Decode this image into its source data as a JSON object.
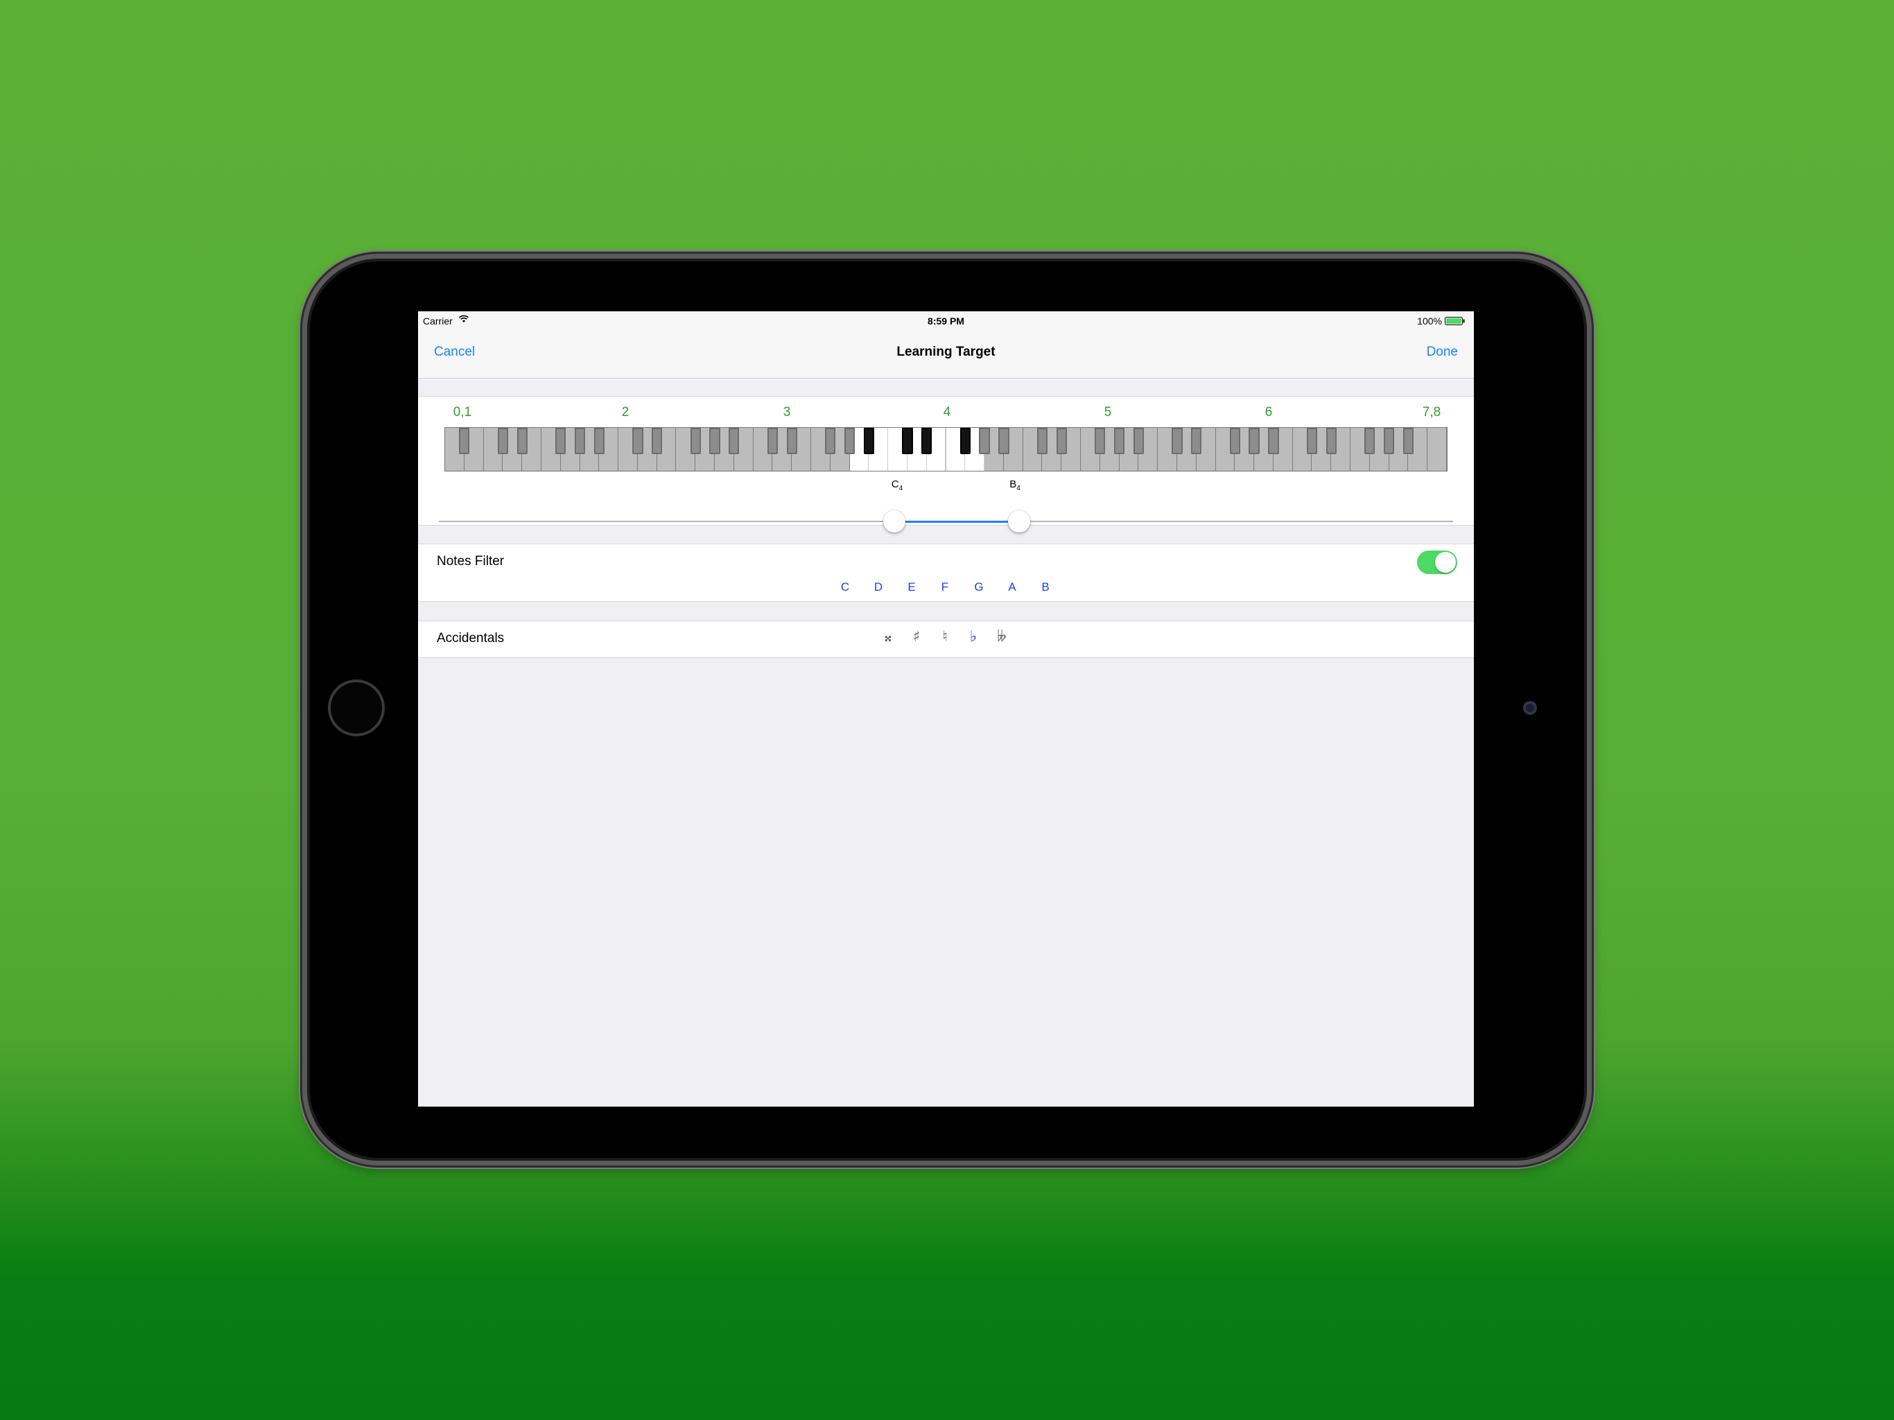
{
  "status_bar": {
    "carrier": "Carrier",
    "time": "8:59 PM",
    "battery": "100%"
  },
  "nav": {
    "cancel_label": "Cancel",
    "title": "Learning Target",
    "done_label": "Done"
  },
  "range": {
    "octave_labels": [
      "0,1",
      "2",
      "3",
      "4",
      "5",
      "6",
      "7,8"
    ],
    "low_note": {
      "letter": "C",
      "octave": "4"
    },
    "high_note": {
      "letter": "B",
      "octave": "4"
    },
    "selected_white_keys": [
      21,
      27
    ]
  },
  "notes_filter": {
    "label": "Notes Filter",
    "enabled": true,
    "notes": [
      "C",
      "D",
      "E",
      "F",
      "G",
      "A",
      "B"
    ]
  },
  "accidentals": {
    "label": "Accidentals",
    "symbols": [
      "𝄪",
      "♯",
      "♮",
      "♭",
      "𝄫"
    ],
    "selected": "♭"
  },
  "colors": {
    "accent": "#1a82fb",
    "octave": "#2f9d2a",
    "selected_note": "#1a3ff2",
    "toggle_on": "#4cd964",
    "background": "#5ab136"
  }
}
